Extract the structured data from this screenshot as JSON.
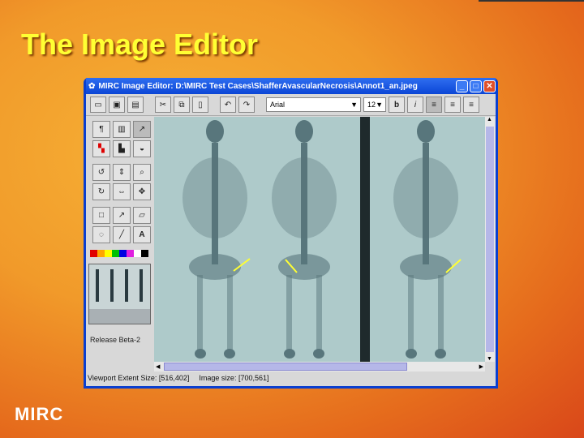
{
  "slide": {
    "title": "The Image Editor",
    "brand": "MIRC"
  },
  "window": {
    "title": "MIRC Image Editor: D:\\MIRC Test Cases\\ShafferAvascularNecrosis\\Annot1_an.jpeg",
    "minimize": "_",
    "maximize": "□",
    "close": "✕"
  },
  "toolbar": {
    "font": "Arial",
    "size": "12",
    "bold": "b",
    "italic": "i",
    "dropdown": "▼"
  },
  "palette": [
    "#e00000",
    "#ffa500",
    "#ffff00",
    "#00c000",
    "#0000e0",
    "#e020e0",
    "#ffffff",
    "#000000"
  ],
  "sidebar": {
    "release": "Release Beta-2"
  },
  "status": {
    "viewport": "Viewport Extent Size: [516,402]",
    "image": "Image size: [700,561]"
  },
  "scroll": {
    "up": "▲",
    "down": "▼",
    "left": "◀",
    "right": "▶"
  }
}
